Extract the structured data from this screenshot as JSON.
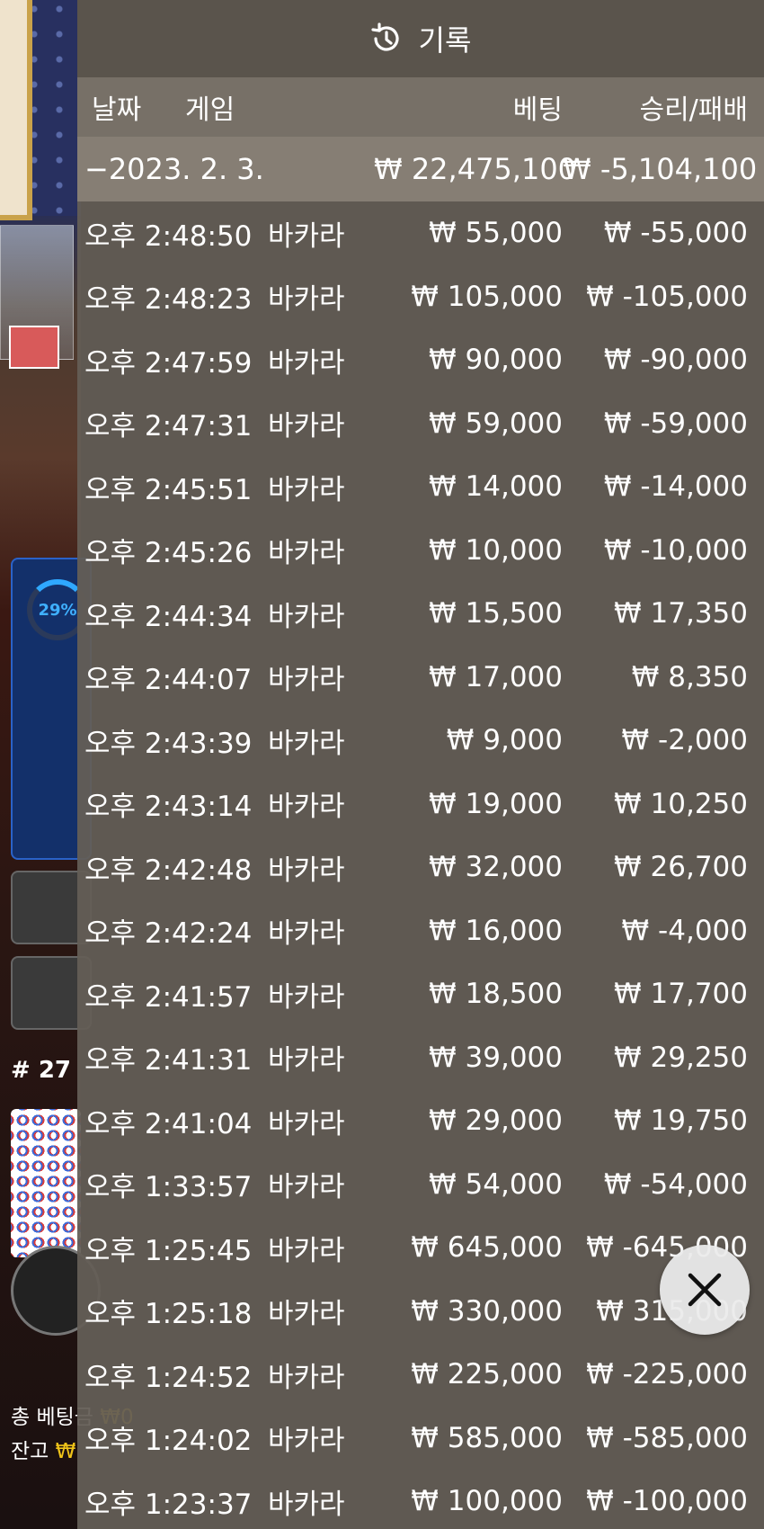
{
  "background": {
    "stat_percent": "29%",
    "round_label": "# 27",
    "footer_bet_label": "총 베팅금",
    "footer_bet_value": "₩0",
    "footer_balance_label": "잔고",
    "footer_balance_value": "₩"
  },
  "header": {
    "icon": "history-icon",
    "title": "기록"
  },
  "columns": {
    "date": "날짜",
    "game": "게임",
    "bet": "베팅",
    "result": "승리/패배"
  },
  "summary": {
    "date": "−2023. 2. 3.",
    "bet": "₩ 22,475,100",
    "result": "₩ -5,104,100"
  },
  "rows": [
    {
      "time": "오후 2:48:50",
      "game": "바카라",
      "bet": "₩ 55,000",
      "result": "₩ -55,000"
    },
    {
      "time": "오후 2:48:23",
      "game": "바카라",
      "bet": "₩ 105,000",
      "result": "₩ -105,000"
    },
    {
      "time": "오후 2:47:59",
      "game": "바카라",
      "bet": "₩ 90,000",
      "result": "₩ -90,000"
    },
    {
      "time": "오후 2:47:31",
      "game": "바카라",
      "bet": "₩ 59,000",
      "result": "₩ -59,000"
    },
    {
      "time": "오후 2:45:51",
      "game": "바카라",
      "bet": "₩ 14,000",
      "result": "₩ -14,000"
    },
    {
      "time": "오후 2:45:26",
      "game": "바카라",
      "bet": "₩ 10,000",
      "result": "₩ -10,000"
    },
    {
      "time": "오후 2:44:34",
      "game": "바카라",
      "bet": "₩ 15,500",
      "result": "₩ 17,350"
    },
    {
      "time": "오후 2:44:07",
      "game": "바카라",
      "bet": "₩ 17,000",
      "result": "₩ 8,350"
    },
    {
      "time": "오후 2:43:39",
      "game": "바카라",
      "bet": "₩ 9,000",
      "result": "₩ -2,000"
    },
    {
      "time": "오후 2:43:14",
      "game": "바카라",
      "bet": "₩ 19,000",
      "result": "₩ 10,250"
    },
    {
      "time": "오후 2:42:48",
      "game": "바카라",
      "bet": "₩ 32,000",
      "result": "₩ 26,700"
    },
    {
      "time": "오후 2:42:24",
      "game": "바카라",
      "bet": "₩ 16,000",
      "result": "₩ -4,000"
    },
    {
      "time": "오후 2:41:57",
      "game": "바카라",
      "bet": "₩ 18,500",
      "result": "₩ 17,700"
    },
    {
      "time": "오후 2:41:31",
      "game": "바카라",
      "bet": "₩ 39,000",
      "result": "₩ 29,250"
    },
    {
      "time": "오후 2:41:04",
      "game": "바카라",
      "bet": "₩ 29,000",
      "result": "₩ 19,750"
    },
    {
      "time": "오후 1:33:57",
      "game": "바카라",
      "bet": "₩ 54,000",
      "result": "₩ -54,000"
    },
    {
      "time": "오후 1:25:45",
      "game": "바카라",
      "bet": "₩ 645,000",
      "result": "₩ -645,000"
    },
    {
      "time": "오후 1:25:18",
      "game": "바카라",
      "bet": "₩ 330,000",
      "result": "₩ 315,000"
    },
    {
      "time": "오후 1:24:52",
      "game": "바카라",
      "bet": "₩ 225,000",
      "result": "₩ -225,000"
    },
    {
      "time": "오후 1:24:02",
      "game": "바카라",
      "bet": "₩ 585,000",
      "result": "₩ -585,000"
    },
    {
      "time": "오후 1:23:37",
      "game": "바카라",
      "bet": "₩ 100,000",
      "result": "₩ -100,000"
    }
  ],
  "close_button": {
    "icon": "close-icon"
  }
}
